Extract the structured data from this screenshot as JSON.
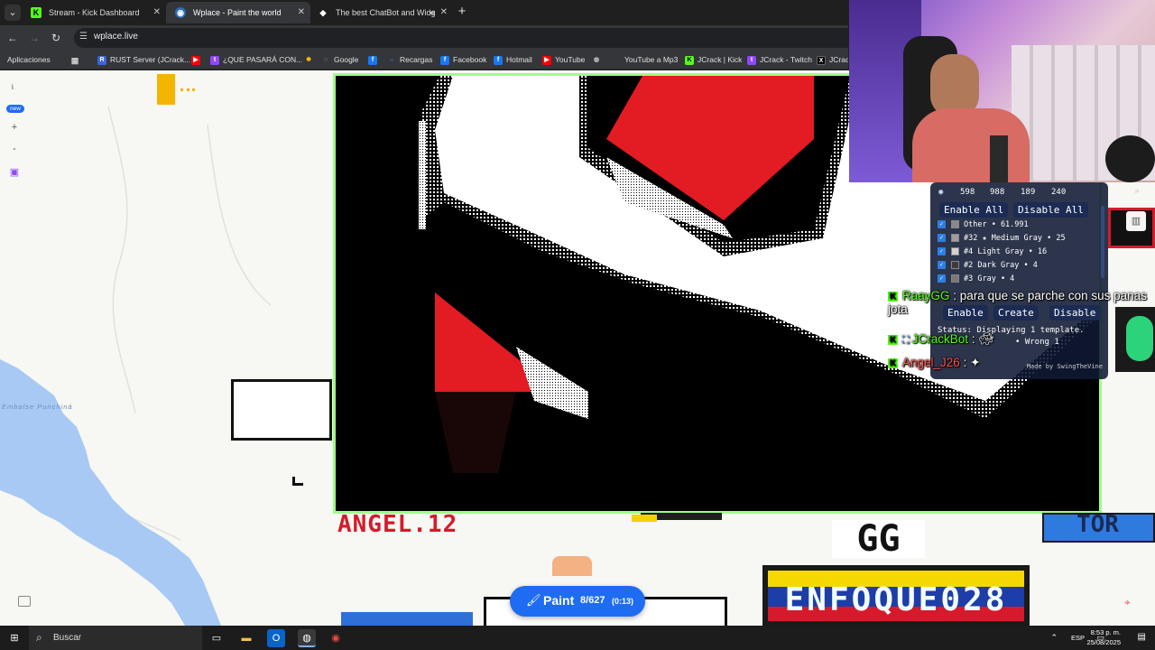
{
  "tabs": [
    {
      "title": "Stream - Kick Dashboard",
      "icon": "kick-icon",
      "color": "#53fc18",
      "active": false
    },
    {
      "title": "Wplace - Paint the world",
      "icon": "globe-icon",
      "color": "#4c9aff",
      "active": true
    },
    {
      "title": "The best ChatBot and Widg",
      "icon": "streamelements-icon",
      "color": "#ffffff",
      "active": false
    }
  ],
  "address": {
    "url": "wplace.live"
  },
  "bookmarks": [
    {
      "label": "Aplicaciones",
      "icon": "apps-grid-icon",
      "color": "#aaaaaa"
    },
    {
      "label": "RUST Server (JCrack...",
      "icon": "rust-icon",
      "color": "#3a64d8"
    },
    {
      "label": "¿QUE PASARÁ CON...",
      "icon": "twitch-icon",
      "color": "#9146ff"
    },
    {
      "label": "Google",
      "icon": "google-icon",
      "color": "#ea4335"
    },
    {
      "label": "Recargas",
      "icon": "recargas-icon",
      "color": "#1e88e5"
    },
    {
      "label": "Facebook",
      "icon": "facebook-icon",
      "color": "#1877f2"
    },
    {
      "label": "Hotmail",
      "icon": "facebook-icon",
      "color": "#1877f2"
    },
    {
      "label": "YouTube",
      "icon": "youtube-icon",
      "color": "#ff0000"
    },
    {
      "label": "YouTube a Mp3",
      "icon": "mp3-icon",
      "color": "#333333"
    },
    {
      "label": "JCrack | Kick",
      "icon": "kick-icon",
      "color": "#53fc18"
    },
    {
      "label": "JCrack - Twitch",
      "icon": "twitch-icon",
      "color": "#9146ff"
    },
    {
      "label": "JCrack",
      "icon": "x-icon",
      "color": "#000000"
    }
  ],
  "map": {
    "labels": {
      "lake_name": "Embalse Punchiná"
    },
    "angel_text": "ANGEL.12",
    "gg_text": "GG",
    "enfoque_text": "ENFOQUE028",
    "blue_text": "TOR",
    "zoom_badge": "new"
  },
  "paint_button": {
    "label": "Paint",
    "count": "8/627",
    "timer": "(0:13)"
  },
  "overlay": {
    "coords": [
      "598",
      "988",
      "189",
      "240"
    ],
    "enable_all": "Enable All",
    "disable_all": "Disable All",
    "colors": [
      {
        "label": "Other • 61.991",
        "swatch": "#888888"
      },
      {
        "label": "#32 ★ Medium Gray • 25",
        "swatch": "#9e9e9e"
      },
      {
        "label": "#4 Light Gray • 16",
        "swatch": "#d2d2d2"
      },
      {
        "label": "#2 Dark Gray • 4",
        "swatch": "#3c3c3c"
      },
      {
        "label": "#3 Gray • 4",
        "swatch": "#787878"
      }
    ],
    "enable": "Enable",
    "create": "Create",
    "disable": "Disable",
    "status": "Status: Displaying 1 template.",
    "status2": "• Wrong 1",
    "made_by": "Made by SwingTheVine"
  },
  "chat": [
    {
      "user": "RaayGG",
      "message": ": para que se parche con sus panas jota",
      "color": "#53fc18"
    },
    {
      "user": "JCrackBot",
      "message": ":",
      "color": "#53fc18"
    },
    {
      "user": "Angel_J26",
      "message": ":",
      "color": "#ff4d4d"
    }
  ],
  "taskbar": {
    "search_placeholder": "Buscar",
    "lang": "ESP",
    "time": "8:53 p. m.",
    "date": "25/08/2025"
  }
}
